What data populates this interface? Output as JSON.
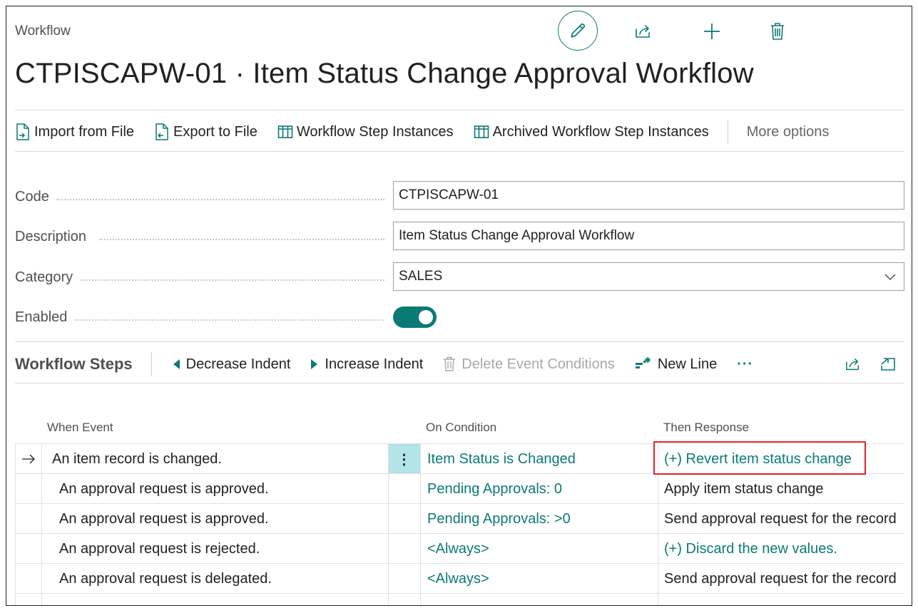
{
  "header": {
    "breadcrumb": "Workflow",
    "title": "CTPISCAPW-01 · Item Status Change Approval Workflow",
    "icons": [
      "pencil-icon",
      "share-icon",
      "plus-icon",
      "trash-icon"
    ]
  },
  "actions": {
    "import": "Import from File",
    "export": "Export to File",
    "step_instances": "Workflow Step Instances",
    "archived_step_instances": "Archived Workflow Step Instances",
    "more": "More options"
  },
  "fields": {
    "code_label": "Code",
    "code_value": "CTPISCAPW-01",
    "description_label": "Description",
    "description_value": "Item Status Change Approval Workflow",
    "category_label": "Category",
    "category_value": "SALES",
    "enabled_label": "Enabled",
    "enabled_value": true
  },
  "steps": {
    "title": "Workflow Steps",
    "decrease": "Decrease Indent",
    "increase": "Increase Indent",
    "delete_conditions": "Delete Event Conditions",
    "new_line": "New Line",
    "ellipsis": "···",
    "columns": {
      "when": "When Event",
      "condition": "On Condition",
      "response": "Then Response"
    },
    "rows": [
      {
        "when": "An item record is changed.",
        "condition": "Item Status is Changed",
        "response": "(+) Revert item status change"
      },
      {
        "when": "An approval request is approved.",
        "condition": "Pending Approvals: 0",
        "response": "Apply item status change"
      },
      {
        "when": "An approval request is approved.",
        "condition": "Pending Approvals: >0",
        "response": "Send approval request for the record"
      },
      {
        "when": "An approval request is rejected.",
        "condition": "<Always>",
        "response": "(+) Discard the new values."
      },
      {
        "when": "An approval request is delegated.",
        "condition": "<Always>",
        "response": "Send approval request for the record"
      }
    ]
  },
  "colors": {
    "accent": "#0b7a75",
    "highlight": "#e0222c",
    "selected_cell": "#b2e4e8"
  }
}
